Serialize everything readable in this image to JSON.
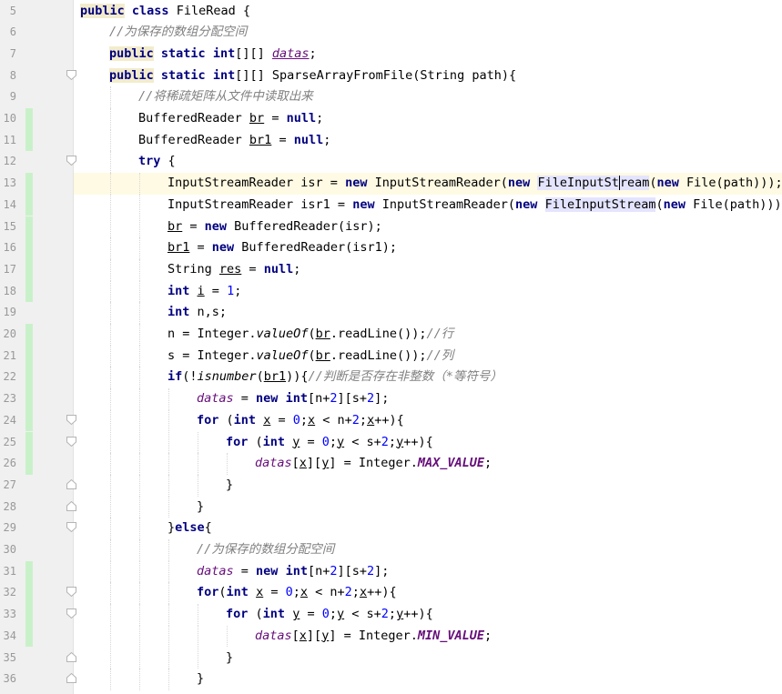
{
  "editor": {
    "current_line": 13,
    "lines": [
      {
        "n": "5",
        "indent": 0,
        "fold": "",
        "change": false,
        "tokens": [
          {
            "t": "public",
            "c": "kw kwhl"
          },
          {
            "t": " "
          },
          {
            "t": "class",
            "c": "kw"
          },
          {
            "t": " FileRead {"
          }
        ]
      },
      {
        "n": "6",
        "indent": 1,
        "fold": "",
        "change": false,
        "tokens": [
          {
            "t": "//为保存的数组分配空间",
            "c": "cm"
          }
        ]
      },
      {
        "n": "7",
        "indent": 1,
        "fold": "",
        "change": false,
        "tokens": [
          {
            "t": "public",
            "c": "kw kwhl"
          },
          {
            "t": " "
          },
          {
            "t": "static",
            "c": "kw"
          },
          {
            "t": " "
          },
          {
            "t": "int",
            "c": "kw"
          },
          {
            "t": "[][] "
          },
          {
            "t": "datas",
            "c": "fld ul"
          },
          {
            "t": ";"
          }
        ]
      },
      {
        "n": "8",
        "indent": 1,
        "fold": "open",
        "change": false,
        "tokens": [
          {
            "t": "public",
            "c": "kw kwhl"
          },
          {
            "t": " "
          },
          {
            "t": "static",
            "c": "kw"
          },
          {
            "t": " "
          },
          {
            "t": "int",
            "c": "kw"
          },
          {
            "t": "[][] SparseArrayFromFile(String path){"
          }
        ]
      },
      {
        "n": "9",
        "indent": 2,
        "fold": "",
        "change": false,
        "tokens": [
          {
            "t": "//将稀疏矩阵从文件中读取出来",
            "c": "cm"
          }
        ]
      },
      {
        "n": "10",
        "indent": 2,
        "fold": "",
        "change": true,
        "tokens": [
          {
            "t": "BufferedReader "
          },
          {
            "t": "br",
            "c": "ul"
          },
          {
            "t": " = "
          },
          {
            "t": "null",
            "c": "kw"
          },
          {
            "t": ";"
          }
        ]
      },
      {
        "n": "11",
        "indent": 2,
        "fold": "",
        "change": true,
        "tokens": [
          {
            "t": "BufferedReader "
          },
          {
            "t": "br1",
            "c": "ul"
          },
          {
            "t": " = "
          },
          {
            "t": "null",
            "c": "kw"
          },
          {
            "t": ";"
          }
        ]
      },
      {
        "n": "12",
        "indent": 2,
        "fold": "open",
        "change": false,
        "tokens": [
          {
            "t": "try",
            "c": "kw"
          },
          {
            "t": " {"
          }
        ]
      },
      {
        "n": "13",
        "indent": 3,
        "fold": "",
        "change": true,
        "tokens": [
          {
            "t": "InputStreamReader isr = "
          },
          {
            "t": "new",
            "c": "kw"
          },
          {
            "t": " InputStreamReader("
          },
          {
            "t": "new",
            "c": "kw"
          },
          {
            "t": " "
          },
          {
            "t": "FileInputSt",
            "c": "hl"
          },
          {
            "t": "ream",
            "c": "hl caret"
          },
          {
            "t": "("
          },
          {
            "t": "new",
            "c": "kw"
          },
          {
            "t": " File(path)));"
          }
        ]
      },
      {
        "n": "14",
        "indent": 3,
        "fold": "",
        "change": true,
        "tokens": [
          {
            "t": "InputStreamReader isr1 = "
          },
          {
            "t": "new",
            "c": "kw"
          },
          {
            "t": " InputStreamReader("
          },
          {
            "t": "new",
            "c": "kw"
          },
          {
            "t": " "
          },
          {
            "t": "FileInputStream",
            "c": "hl"
          },
          {
            "t": "("
          },
          {
            "t": "new",
            "c": "kw"
          },
          {
            "t": " File(path)));"
          }
        ]
      },
      {
        "n": "15",
        "indent": 3,
        "fold": "",
        "change": true,
        "tokens": [
          {
            "t": "br",
            "c": "ul"
          },
          {
            "t": " = "
          },
          {
            "t": "new",
            "c": "kw"
          },
          {
            "t": " BufferedReader(isr);"
          }
        ]
      },
      {
        "n": "16",
        "indent": 3,
        "fold": "",
        "change": true,
        "tokens": [
          {
            "t": "br1",
            "c": "ul"
          },
          {
            "t": " = "
          },
          {
            "t": "new",
            "c": "kw"
          },
          {
            "t": " BufferedReader(isr1);"
          }
        ]
      },
      {
        "n": "17",
        "indent": 3,
        "fold": "",
        "change": true,
        "tokens": [
          {
            "t": "String "
          },
          {
            "t": "res",
            "c": "ul"
          },
          {
            "t": " = "
          },
          {
            "t": "null",
            "c": "kw"
          },
          {
            "t": ";"
          }
        ]
      },
      {
        "n": "18",
        "indent": 3,
        "fold": "",
        "change": true,
        "tokens": [
          {
            "t": "int",
            "c": "kw"
          },
          {
            "t": " "
          },
          {
            "t": "i",
            "c": "ul"
          },
          {
            "t": " = "
          },
          {
            "t": "1",
            "c": "num"
          },
          {
            "t": ";"
          }
        ]
      },
      {
        "n": "19",
        "indent": 3,
        "fold": "",
        "change": false,
        "tokens": [
          {
            "t": "int",
            "c": "kw"
          },
          {
            "t": " n,s;"
          }
        ]
      },
      {
        "n": "20",
        "indent": 3,
        "fold": "",
        "change": true,
        "tokens": [
          {
            "t": "n = Integer."
          },
          {
            "t": "valueOf",
            "c": "smth"
          },
          {
            "t": "("
          },
          {
            "t": "br",
            "c": "ul"
          },
          {
            "t": ".readLine());"
          },
          {
            "t": "//行",
            "c": "cm"
          }
        ]
      },
      {
        "n": "21",
        "indent": 3,
        "fold": "",
        "change": true,
        "tokens": [
          {
            "t": "s = Integer."
          },
          {
            "t": "valueOf",
            "c": "smth"
          },
          {
            "t": "("
          },
          {
            "t": "br",
            "c": "ul"
          },
          {
            "t": ".readLine());"
          },
          {
            "t": "//列",
            "c": "cm"
          }
        ]
      },
      {
        "n": "22",
        "indent": 3,
        "fold": "",
        "change": true,
        "tokens": [
          {
            "t": "if",
            "c": "kw"
          },
          {
            "t": "(!"
          },
          {
            "t": "isnumber",
            "c": "smth"
          },
          {
            "t": "("
          },
          {
            "t": "br1",
            "c": "ul"
          },
          {
            "t": ")){"
          },
          {
            "t": "//判断是否存在非整数（*等符号）",
            "c": "cm"
          }
        ]
      },
      {
        "n": "23",
        "indent": 4,
        "fold": "",
        "change": true,
        "tokens": [
          {
            "t": "datas",
            "c": "fld"
          },
          {
            "t": " = "
          },
          {
            "t": "new",
            "c": "kw"
          },
          {
            "t": " "
          },
          {
            "t": "int",
            "c": "kw"
          },
          {
            "t": "[n+"
          },
          {
            "t": "2",
            "c": "num"
          },
          {
            "t": "][s+"
          },
          {
            "t": "2",
            "c": "num"
          },
          {
            "t": "];"
          }
        ]
      },
      {
        "n": "24",
        "indent": 4,
        "fold": "open",
        "change": true,
        "tokens": [
          {
            "t": "for",
            "c": "kw"
          },
          {
            "t": " ("
          },
          {
            "t": "int",
            "c": "kw"
          },
          {
            "t": " "
          },
          {
            "t": "x",
            "c": "ul"
          },
          {
            "t": " = "
          },
          {
            "t": "0",
            "c": "num"
          },
          {
            "t": ";"
          },
          {
            "t": "x",
            "c": "ul"
          },
          {
            "t": " < n+"
          },
          {
            "t": "2",
            "c": "num"
          },
          {
            "t": ";"
          },
          {
            "t": "x",
            "c": "ul"
          },
          {
            "t": "++){"
          }
        ]
      },
      {
        "n": "25",
        "indent": 5,
        "fold": "open",
        "change": true,
        "tokens": [
          {
            "t": "for",
            "c": "kw"
          },
          {
            "t": " ("
          },
          {
            "t": "int",
            "c": "kw"
          },
          {
            "t": " "
          },
          {
            "t": "y",
            "c": "ul"
          },
          {
            "t": " = "
          },
          {
            "t": "0",
            "c": "num"
          },
          {
            "t": ";"
          },
          {
            "t": "y",
            "c": "ul"
          },
          {
            "t": " < s+"
          },
          {
            "t": "2",
            "c": "num"
          },
          {
            "t": ";"
          },
          {
            "t": "y",
            "c": "ul"
          },
          {
            "t": "++){"
          }
        ]
      },
      {
        "n": "26",
        "indent": 6,
        "fold": "",
        "change": true,
        "tokens": [
          {
            "t": "datas",
            "c": "fld"
          },
          {
            "t": "["
          },
          {
            "t": "x",
            "c": "ul"
          },
          {
            "t": "]["
          },
          {
            "t": "y",
            "c": "ul"
          },
          {
            "t": "] = Integer."
          },
          {
            "t": "MAX_VALUE",
            "c": "sfld"
          },
          {
            "t": ";"
          }
        ]
      },
      {
        "n": "27",
        "indent": 5,
        "fold": "close",
        "change": false,
        "tokens": [
          {
            "t": "}"
          }
        ]
      },
      {
        "n": "28",
        "indent": 4,
        "fold": "close",
        "change": false,
        "tokens": [
          {
            "t": "}"
          }
        ]
      },
      {
        "n": "29",
        "indent": 3,
        "fold": "open",
        "change": false,
        "tokens": [
          {
            "t": "}"
          },
          {
            "t": "else",
            "c": "kw"
          },
          {
            "t": "{"
          }
        ]
      },
      {
        "n": "30",
        "indent": 4,
        "fold": "",
        "change": false,
        "tokens": [
          {
            "t": "//为保存的数组分配空间",
            "c": "cm"
          }
        ]
      },
      {
        "n": "31",
        "indent": 4,
        "fold": "",
        "change": true,
        "tokens": [
          {
            "t": "datas",
            "c": "fld"
          },
          {
            "t": " = "
          },
          {
            "t": "new",
            "c": "kw"
          },
          {
            "t": " "
          },
          {
            "t": "int",
            "c": "kw"
          },
          {
            "t": "[n+"
          },
          {
            "t": "2",
            "c": "num"
          },
          {
            "t": "][s+"
          },
          {
            "t": "2",
            "c": "num"
          },
          {
            "t": "];"
          }
        ]
      },
      {
        "n": "32",
        "indent": 4,
        "fold": "open",
        "change": true,
        "tokens": [
          {
            "t": "for",
            "c": "kw"
          },
          {
            "t": "("
          },
          {
            "t": "int",
            "c": "kw"
          },
          {
            "t": " "
          },
          {
            "t": "x",
            "c": "ul"
          },
          {
            "t": " = "
          },
          {
            "t": "0",
            "c": "num"
          },
          {
            "t": ";"
          },
          {
            "t": "x",
            "c": "ul"
          },
          {
            "t": " < n+"
          },
          {
            "t": "2",
            "c": "num"
          },
          {
            "t": ";"
          },
          {
            "t": "x",
            "c": "ul"
          },
          {
            "t": "++){"
          }
        ]
      },
      {
        "n": "33",
        "indent": 5,
        "fold": "open",
        "change": true,
        "tokens": [
          {
            "t": "for",
            "c": "kw"
          },
          {
            "t": " ("
          },
          {
            "t": "int",
            "c": "kw"
          },
          {
            "t": " "
          },
          {
            "t": "y",
            "c": "ul"
          },
          {
            "t": " = "
          },
          {
            "t": "0",
            "c": "num"
          },
          {
            "t": ";"
          },
          {
            "t": "y",
            "c": "ul"
          },
          {
            "t": " < s+"
          },
          {
            "t": "2",
            "c": "num"
          },
          {
            "t": ";"
          },
          {
            "t": "y",
            "c": "ul"
          },
          {
            "t": "++){"
          }
        ]
      },
      {
        "n": "34",
        "indent": 6,
        "fold": "",
        "change": true,
        "tokens": [
          {
            "t": "datas",
            "c": "fld"
          },
          {
            "t": "["
          },
          {
            "t": "x",
            "c": "ul"
          },
          {
            "t": "]["
          },
          {
            "t": "y",
            "c": "ul"
          },
          {
            "t": "] = Integer."
          },
          {
            "t": "MIN_VALUE",
            "c": "sfld"
          },
          {
            "t": ";"
          }
        ]
      },
      {
        "n": "35",
        "indent": 5,
        "fold": "close",
        "change": false,
        "tokens": [
          {
            "t": "}"
          }
        ]
      },
      {
        "n": "36",
        "indent": 4,
        "fold": "close",
        "change": false,
        "tokens": [
          {
            "t": "}"
          }
        ]
      }
    ]
  }
}
